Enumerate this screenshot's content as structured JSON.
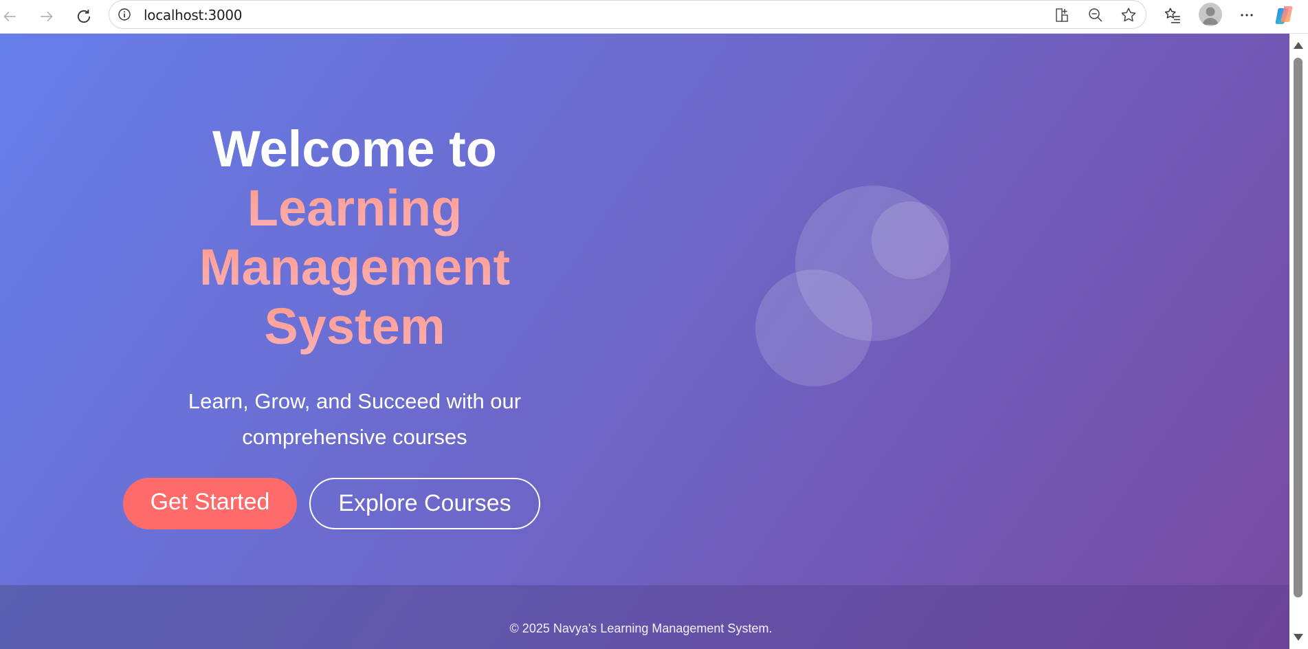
{
  "browser": {
    "url": "localhost:3000",
    "icons": [
      "back-icon",
      "forward-icon",
      "refresh-icon",
      "info-icon",
      "app-available-icon",
      "zoom-out-icon",
      "favorite-star-icon",
      "favorites-list-icon",
      "profile-avatar-icon",
      "more-menu-icon",
      "copilot-icon"
    ]
  },
  "hero": {
    "title_line1": "Welcome to",
    "title_line2": "Learning",
    "title_line3": "Management",
    "title_line4": "System",
    "subtitle": "Learn, Grow, and Succeed with our comprehensive courses",
    "primary_button": "Get Started",
    "secondary_button": "Explore Courses",
    "accent_color": "#ff6b6b",
    "gradient": [
      "#667eea",
      "#764ba2"
    ]
  },
  "footer": {
    "text": "© 2025 Navya's Learning Management System."
  }
}
